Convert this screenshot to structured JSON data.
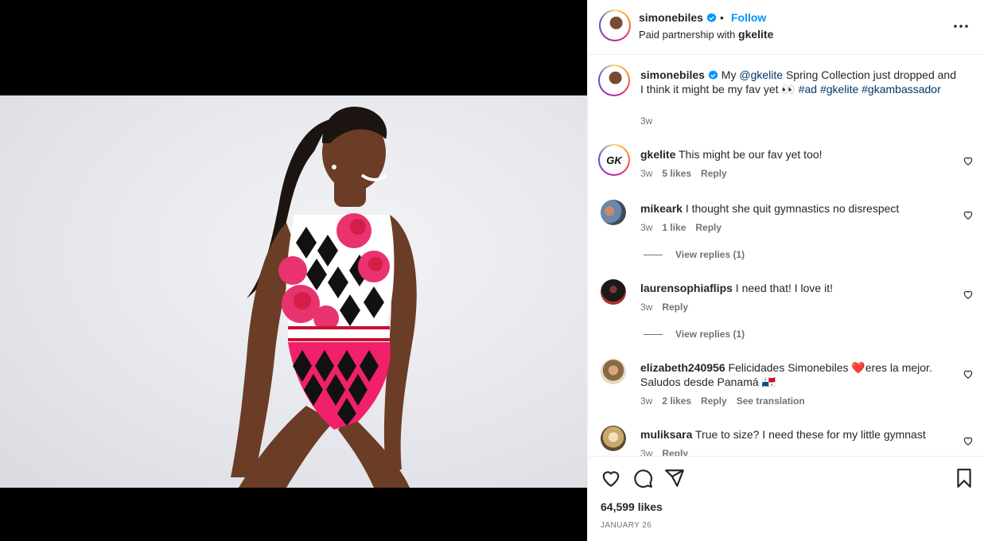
{
  "post": {
    "author": "simonebiles",
    "follow_label": "Follow",
    "separator": "•",
    "partnership_prefix": "Paid partnership with ",
    "partner": "gkelite"
  },
  "caption": {
    "user": "simonebiles",
    "text_before": " My ",
    "mention": "@gkelite",
    "text_after": " Spring Collection just dropped and I think it might be my fav yet 👀 ",
    "tag1": "#ad",
    "tag2": "#gkelite",
    "tag3": "#gkambassador",
    "time": "3w"
  },
  "comments": [
    {
      "user": "gkelite",
      "text": " This might be our fav yet too!",
      "time": "3w",
      "likes": "5 likes",
      "reply": "Reply"
    },
    {
      "user": "mikeark",
      "text": " I thought she quit gymnastics no disrespect",
      "time": "3w",
      "likes": "1 like",
      "reply": "Reply",
      "view_replies": "View replies (1)"
    },
    {
      "user": "laurensophiaflips",
      "text": " I need that! I love it!",
      "time": "3w",
      "reply": "Reply",
      "view_replies": "View replies (1)"
    },
    {
      "user": "elizabeth240956",
      "text": " Felicidades Simonebiles ❤️eres la mejor. Saludos desde Panamá 🇵🇦",
      "time": "3w",
      "likes": "2 likes",
      "reply": "Reply",
      "translate": "See translation"
    },
    {
      "user": "muliksara",
      "text": " True to size? I need these for my little gymnast",
      "time": "3w",
      "reply": "Reply"
    }
  ],
  "footer": {
    "likes": "64,599 likes",
    "date": "JANUARY 26"
  },
  "icons": {
    "like": "heart-icon",
    "comment": "comment-icon",
    "share": "share-icon",
    "save": "bookmark-icon",
    "more": "more-options-icon",
    "verified": "verified-badge-icon"
  },
  "colors": {
    "link": "#00376b",
    "follow": "#0095f6",
    "verified": "#0095f6",
    "meta": "#737373"
  }
}
